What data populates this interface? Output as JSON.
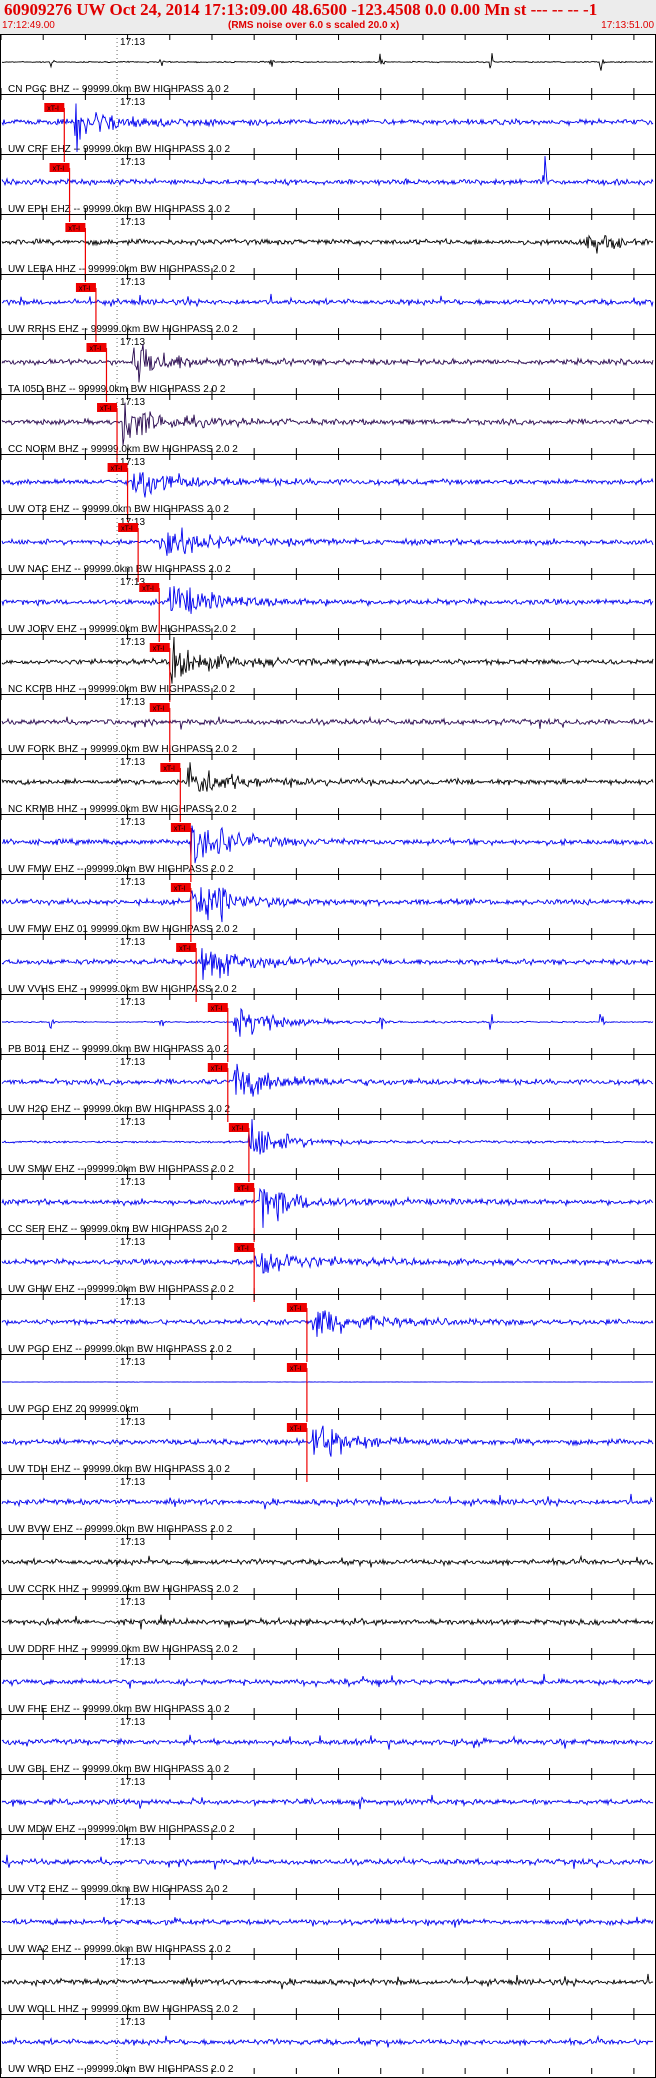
{
  "header": {
    "title": "60909276 UW Oct 24, 2014 17:13:09.00   48.6500 -123.4508  0.0 0.00 Mn st --- -- --  -1",
    "start_time": "17:12:49.00",
    "note": "(RMS noise over 6.0 s scaled 20.0 x)",
    "end_time": "17:13:51.00",
    "bg_color": "#ececec",
    "text_color": "#e00000"
  },
  "chart_data": {
    "type": "line",
    "x_range": [
      "17:12:49.00",
      "17:13:51.00"
    ],
    "x_tick_label": "17:13",
    "pick_label": "xT-I",
    "colors": {
      "blue": "#0000ee",
      "black": "#000000",
      "purple": "#2a0a50",
      "pick": "#ee0000"
    },
    "traces": [
      {
        "label": "CN PGC BHZ -- 99999.0km BW  HIGHPASS  2.0  2",
        "color": "black",
        "style": "pulses",
        "pick": null
      },
      {
        "label": "UW CRF EHZ -- 99999.0km BW  HIGHPASS  2.0  2",
        "color": "blue",
        "style": "event",
        "pick": "17:12:55.0",
        "event": "17:12:56.0"
      },
      {
        "label": "UW EPH EHZ -- 99999.0km BW  HIGHPASS  2.0  2",
        "color": "blue",
        "style": "spike",
        "pick": "17:12:55.5",
        "spike": "17:13:40.5"
      },
      {
        "label": "UW LEBA HHZ -- 99999.0km BW  HIGHPASS  2.0  2",
        "color": "black",
        "style": "late",
        "pick": "17:12:57.0",
        "late": "17:13:46.0"
      },
      {
        "label": "UW RRHS EHZ -- 99999.0km BW  HIGHPASS  2.0  2",
        "color": "blue",
        "style": "noise",
        "pick": "17:12:58.0"
      },
      {
        "label": "TA I05D BHZ -- 99999.0km BW  HIGHPASS  2.0  2",
        "color": "purple",
        "style": "event",
        "pick": "17:12:59.0",
        "event": "17:13:01.5"
      },
      {
        "label": "CC NORM BHZ -- 99999.0km BW  HIGHPASS  2.0  2",
        "color": "purple",
        "style": "emergent",
        "pick": "17:13:00.0",
        "event": "17:13:00.5"
      },
      {
        "label": "UW OT3 EHZ -- 99999.0km BW  HIGHPASS  2.0  2",
        "color": "blue",
        "style": "emergent",
        "pick": "17:13:01.0",
        "event": "17:13:01.5"
      },
      {
        "label": "UW NAC EHZ -- 99999.0km BW  HIGHPASS  2.0  2",
        "color": "blue",
        "style": "event",
        "pick": "17:13:02.0",
        "event": "17:13:04.0"
      },
      {
        "label": "UW JORV EHZ -- 99999.0km BW  HIGHPASS  2.0  2",
        "color": "blue",
        "style": "event",
        "pick": "17:13:04.0",
        "event": "17:13:05.0"
      },
      {
        "label": "NC KCPB HHZ -- 99999.0km BW  HIGHPASS  2.0  2",
        "color": "black",
        "style": "event",
        "pick": "17:13:05.0",
        "event": "17:13:05.0"
      },
      {
        "label": "UW FORK BHZ -- 99999.0km BW  HIGHPASS  2.0  2",
        "color": "purple",
        "style": "noise",
        "pick": "17:13:05.0"
      },
      {
        "label": "NC KRMB HHZ -- 99999.0km BW  HIGHPASS  2.0  2",
        "color": "black",
        "style": "event",
        "pick": "17:13:06.0",
        "event": "17:13:06.5"
      },
      {
        "label": "UW FMW EHZ -- 99999.0km BW  HIGHPASS  2.0  2",
        "color": "blue",
        "style": "double",
        "pick": "17:13:07.0",
        "event": "17:13:07.0",
        "event2": "17:13:09.5"
      },
      {
        "label": "UW FMW EHZ 01 99999.0km BW  HIGHPASS  2.0  2",
        "color": "blue",
        "style": "double",
        "pick": "17:13:07.0",
        "event": "17:13:07.0",
        "event2": "17:13:09.5"
      },
      {
        "label": "UW VVHS EHZ -- 99999.0km BW  HIGHPASS  2.0  2",
        "color": "blue",
        "style": "event",
        "pick": "17:13:07.5",
        "event": "17:13:08.0"
      },
      {
        "label": "PB B011 EHZ -- 99999.0km BW  HIGHPASS  2.0  2",
        "color": "blue",
        "style": "pulses",
        "pick": "17:13:10.5",
        "event": "17:13:11.0"
      },
      {
        "label": "UW H2O EHZ -- 99999.0km BW  HIGHPASS  2.0  2",
        "color": "blue",
        "style": "event",
        "pick": "17:13:10.5",
        "event": "17:13:11.0"
      },
      {
        "label": "UW SMW EHZ -- 99999.0km BW  HIGHPASS  2.0  2",
        "color": "blue",
        "style": "quiet",
        "pick": "17:13:12.5",
        "event": "17:13:12.5"
      },
      {
        "label": "CC SEP EHZ -- 99999.0km BW  HIGHPASS  2.0  2",
        "color": "blue",
        "style": "event",
        "pick": "17:13:13.0",
        "event": "17:13:13.5"
      },
      {
        "label": "UW GHW EHZ -- 99999.0km BW  HIGHPASS  2.0  2",
        "color": "blue",
        "style": "event",
        "pick": "17:13:13.0",
        "event": "17:13:13.0"
      },
      {
        "label": "UW PGO EHZ -- 99999.0km BW  HIGHPASS  2.0  2",
        "color": "blue",
        "style": "event",
        "pick": "17:13:18.0",
        "event": "17:13:18.5"
      },
      {
        "label": "UW PGO EHZ 20 99999.0km",
        "color": "blue",
        "style": "flat",
        "pick": "17:13:18.0"
      },
      {
        "label": "UW TDH EHZ -- 99999.0km BW  HIGHPASS  2.0  2",
        "color": "blue",
        "style": "event",
        "pick": "17:13:18.0",
        "event": "17:13:18.5"
      },
      {
        "label": "UW BVW EHZ -- 99999.0km BW  HIGHPASS  2.0  2",
        "color": "blue",
        "style": "noise",
        "pick": null
      },
      {
        "label": "UW CCRK HHZ -- 99999.0km BW  HIGHPASS  2.0  2",
        "color": "black",
        "style": "noise",
        "pick": null
      },
      {
        "label": "UW DDRF HHZ -- 99999.0km BW  HIGHPASS  2.0  2",
        "color": "black",
        "style": "noise",
        "pick": null
      },
      {
        "label": "UW FHE EHZ -- 99999.0km BW  HIGHPASS  2.0  2",
        "color": "blue",
        "style": "noise",
        "pick": null
      },
      {
        "label": "UW GBL EHZ -- 99999.0km BW  HIGHPASS  2.0  2",
        "color": "blue",
        "style": "noise",
        "pick": null
      },
      {
        "label": "UW MDW EHZ -- 99999.0km BW  HIGHPASS  2.0  2",
        "color": "blue",
        "style": "noise",
        "pick": null
      },
      {
        "label": "UW VT2 EHZ -- 99999.0km BW  HIGHPASS  2.0  2",
        "color": "blue",
        "style": "noise",
        "pick": null
      },
      {
        "label": "UW WA2 EHZ -- 99999.0km BW  HIGHPASS  2.0  2",
        "color": "blue",
        "style": "noise",
        "pick": null
      },
      {
        "label": "UW WOLL HHZ -- 99999.0km BW  HIGHPASS  2.0  2",
        "color": "black",
        "style": "noise",
        "pick": null
      },
      {
        "label": "UW WRD EHZ -- 99999.0km BW  HIGHPASS  2.0  2",
        "color": "blue",
        "style": "noise",
        "pick": null
      }
    ]
  }
}
